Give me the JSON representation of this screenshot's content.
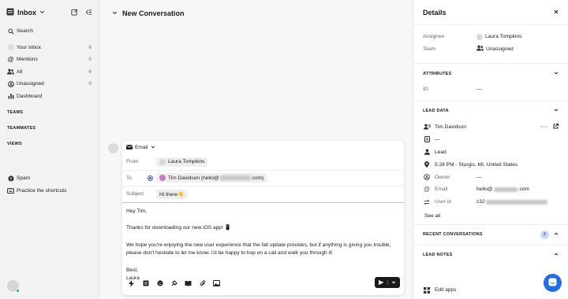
{
  "sidebar": {
    "title": "Inbox",
    "search": "Search",
    "items": [
      {
        "label": "Your inbox",
        "count": "6"
      },
      {
        "label": "Mentions",
        "count": "0"
      },
      {
        "label": "All",
        "count": "6"
      },
      {
        "label": "Unassigned",
        "count": "0"
      },
      {
        "label": "Dashboard",
        "count": ""
      }
    ],
    "sections": {
      "teams": "TEAMS",
      "teammates": "TEAMMATES",
      "views": "VIEWS"
    },
    "bottom": [
      {
        "label": "Spam"
      },
      {
        "label": "Practice the shortcuts"
      }
    ]
  },
  "conversation": {
    "title": "New Conversation",
    "channel": "Email",
    "from_label": "From",
    "from_value": "Laura Tompkins",
    "to_label": "To",
    "to_value": "Tim Davidson (hello@",
    "to_value_end": ".com)",
    "subject_label": "Subject",
    "subject_value": "Hi there👋",
    "body": [
      "Hey Tim,",
      "Thanks for downloading our new iOS app! 📱",
      "We hope you're enjoying the new user experience that the fall update provides, but if anything is giving you trouble, please don't hesitate to let me know. I'd be happy to hop on a call and walk you through it!",
      "Best,",
      "Laura"
    ]
  },
  "details": {
    "title": "Details",
    "assignee_label": "Assignee",
    "assignee_value": "Laura Tompkins",
    "team_label": "Team",
    "team_value": "Unassigned",
    "attributes_header": "ATTRIBUTES",
    "id_label": "ID",
    "id_value": "—",
    "lead_data_header": "LEAD DATA",
    "lead_name": "Tim Davidson",
    "lead_dash": "—",
    "lead_type": "Lead",
    "location": "5:28 PM · Sturgis, MI, United States",
    "owner_label": "Owner",
    "owner_value": "—",
    "email_label": "Email",
    "email_value": "hello@",
    "email_value_end": ".com",
    "userid_label": "User id",
    "userid_value": "c32",
    "see_all": "See all",
    "recent_header": "RECENT CONVERSATIONS",
    "recent_count": "2",
    "notes_header": "LEAD NOTES",
    "edit_apps": "Edit apps"
  },
  "colors": {
    "accent": "#1f6ee8",
    "send_button": "#1a1a1a",
    "radio": "#3a4fd0",
    "online": "#2cb34a"
  }
}
